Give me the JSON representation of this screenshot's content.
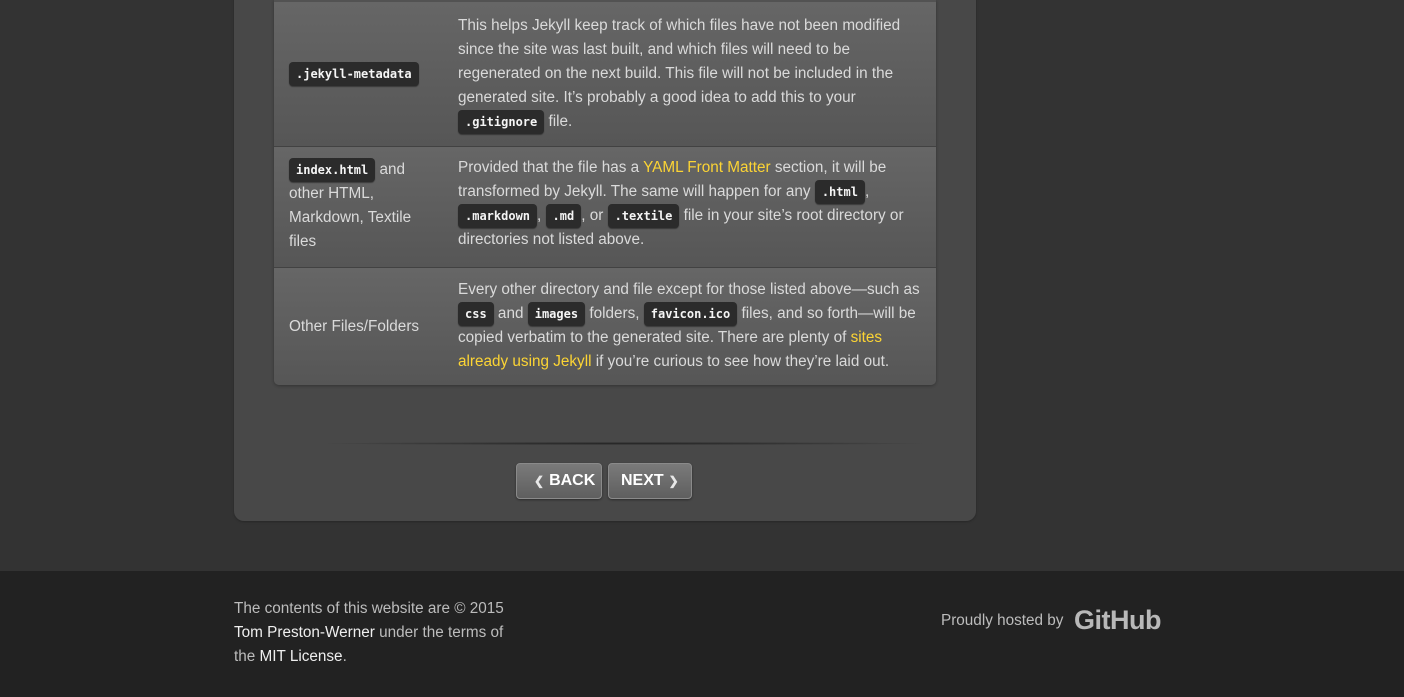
{
  "table": {
    "rows": [
      {
        "file_code": ".jekyll-metadata",
        "desc_1": "This helps Jekyll keep track of which files have not been modified since the site was last built, and which files will need to be regenerated on the next build. This file will not be included in the generated site. It’s probably a good idea to add this to your ",
        "desc_code": ".gitignore",
        "desc_2": " file."
      },
      {
        "file_code": "index.html",
        "file_text_1": " and",
        "file_text_2": "other HTML,",
        "file_text_3": "Markdown, Textile",
        "file_text_4": "files",
        "desc_1": "Provided that the file has a ",
        "desc_link": "YAML Front Matter",
        "desc_2": " section, it will be transformed by Jekyll. The same will happen for any ",
        "code_1": ".html",
        "sep_1": ", ",
        "code_2": ".markdown",
        "sep_2": ", ",
        "code_3": ".md",
        "sep_3": ", or ",
        "code_4": ".textile",
        "desc_3": " file in your site’s root directory or directories not listed above."
      },
      {
        "file_text": "Other Files/Folders",
        "desc_1": "Every other directory and file except for those listed above—such as ",
        "code_1": "css",
        "sep_1": " and ",
        "code_2": "images",
        "sep_2": " folders, ",
        "code_3": "favicon.ico",
        "desc_2": " files, and so forth—will be copied verbatim to the generated site. There are plenty of ",
        "desc_link": "sites already using Jekyll",
        "desc_3": " if you’re curious to see how they’re laid out."
      }
    ]
  },
  "nav": {
    "back_label": "BACK",
    "next_label": "NEXT",
    "back_arrow": "❮",
    "next_arrow": "❯"
  },
  "footer": {
    "copyright_1": "The contents of this website are © 2015",
    "author_link": "Tom Preston-Werner",
    "copyright_2": " under the terms of the ",
    "license_link": "MIT License",
    "copyright_3": ".",
    "hosted_by": "Proudly hosted by",
    "github_logo": "GitHub"
  }
}
